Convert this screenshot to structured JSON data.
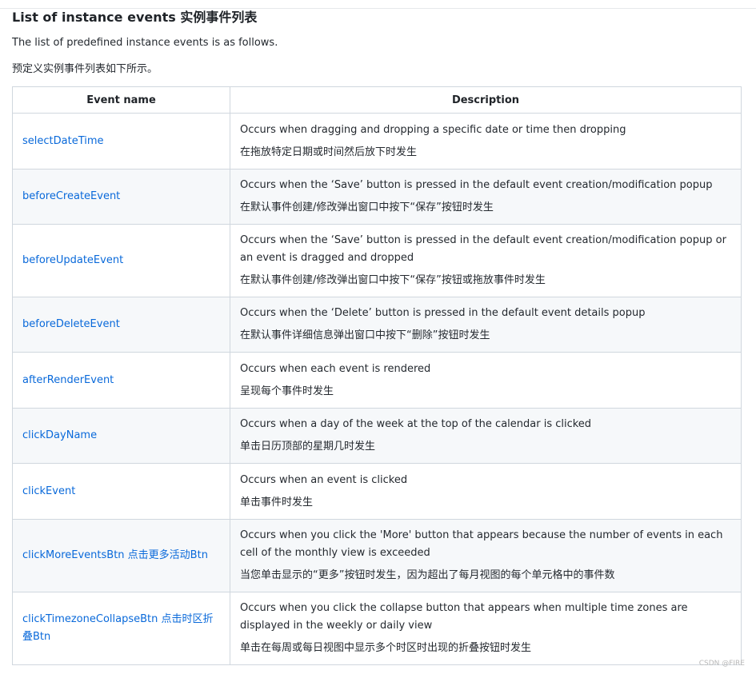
{
  "heading": "List of instance events 实例事件列表",
  "intro_en": "The list of predefined instance events is as follows.",
  "intro_zh": "预定义实例事件列表如下所示。",
  "table": {
    "headers": [
      "Event name",
      "Description"
    ],
    "rows": [
      {
        "name": "selectDateTime",
        "en": "Occurs when dragging and dropping a specific date or time then dropping",
        "zh": "在拖放特定日期或时间然后放下时发生"
      },
      {
        "name": "beforeCreateEvent",
        "en": "Occurs when the ‘Save’ button is pressed in the default event creation/modification popup",
        "zh": "在默认事件创建/修改弹出窗口中按下“保存”按钮时发生"
      },
      {
        "name": "beforeUpdateEvent",
        "en": "Occurs when the ‘Save’ button is pressed in the default event creation/modification popup or an event is dragged and dropped",
        "zh": "在默认事件创建/修改弹出窗口中按下“保存”按钮或拖放事件时发生"
      },
      {
        "name": "beforeDeleteEvent",
        "en": "Occurs when the ‘Delete’ button is pressed in the default event details popup",
        "zh": "在默认事件详细信息弹出窗口中按下“删除”按钮时发生"
      },
      {
        "name": "afterRenderEvent",
        "en": "Occurs when each event is rendered",
        "zh": "呈现每个事件时发生"
      },
      {
        "name": "clickDayName",
        "en": "Occurs when a day of the week at the top of the calendar is clicked",
        "zh": "单击日历顶部的星期几时发生"
      },
      {
        "name": "clickEvent",
        "en": "Occurs when an event is clicked",
        "zh": "单击事件时发生"
      },
      {
        "name": "clickMoreEventsBtn 点击更多活动Btn",
        "en": "Occurs when you click the 'More' button that appears because the number of events in each cell of the monthly view is exceeded",
        "zh": "当您单击显示的“更多”按钮时发生，因为超出了每月视图的每个单元格中的事件数"
      },
      {
        "name": "clickTimezoneCollapseBtn 点击时区折叠Btn",
        "en": "Occurs when you click the collapse button that appears when multiple time zones are displayed in the weekly or daily view",
        "zh": "单击在每周或每日视图中显示多个时区时出现的折叠按钮时发生"
      }
    ]
  },
  "watermark": "CSDN @FIRE"
}
